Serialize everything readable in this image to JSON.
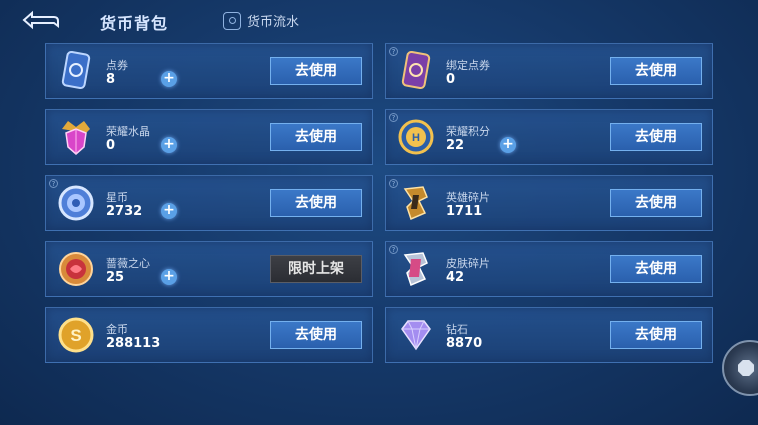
{
  "header": {
    "back_icon": "back-arrow-icon",
    "bag_tab": "货币背包",
    "flow_tab": "货币流水"
  },
  "currencies": [
    {
      "name": "点券",
      "value": "8",
      "icon": "voucher-card-icon",
      "has_plus": true,
      "action": "去使用",
      "help": false
    },
    {
      "name": "绑定点券",
      "value": "0",
      "icon": "bound-voucher-card-icon",
      "has_plus": false,
      "action": "去使用",
      "help": true
    },
    {
      "name": "荣耀水晶",
      "value": "0",
      "icon": "glory-crystal-icon",
      "has_plus": true,
      "action": "去使用",
      "help": false
    },
    {
      "name": "荣耀积分",
      "value": "22",
      "icon": "glory-points-icon",
      "has_plus": true,
      "action": "去使用",
      "help": true
    },
    {
      "name": "星币",
      "value": "2732",
      "icon": "star-coin-icon",
      "has_plus": true,
      "action": "去使用",
      "help": true
    },
    {
      "name": "英雄碎片",
      "value": "1711",
      "icon": "hero-fragment-icon",
      "has_plus": false,
      "action": "去使用",
      "help": true
    },
    {
      "name": "蔷薇之心",
      "value": "25",
      "icon": "rose-heart-icon",
      "has_plus": true,
      "action": "限时上架",
      "help": false
    },
    {
      "name": "皮肤碎片",
      "value": "42",
      "icon": "skin-fragment-icon",
      "has_plus": false,
      "action": "去使用",
      "help": true
    },
    {
      "name": "金币",
      "value": "288113",
      "icon": "gold-coin-icon",
      "has_plus": false,
      "action": "去使用",
      "help": false
    },
    {
      "name": "钻石",
      "value": "8870",
      "icon": "diamond-icon",
      "has_plus": false,
      "action": "去使用",
      "help": false
    }
  ],
  "colors": {
    "accent": "#3b78c8",
    "plus": "#5aa0e6",
    "disabled_button": "#2b2d33"
  }
}
